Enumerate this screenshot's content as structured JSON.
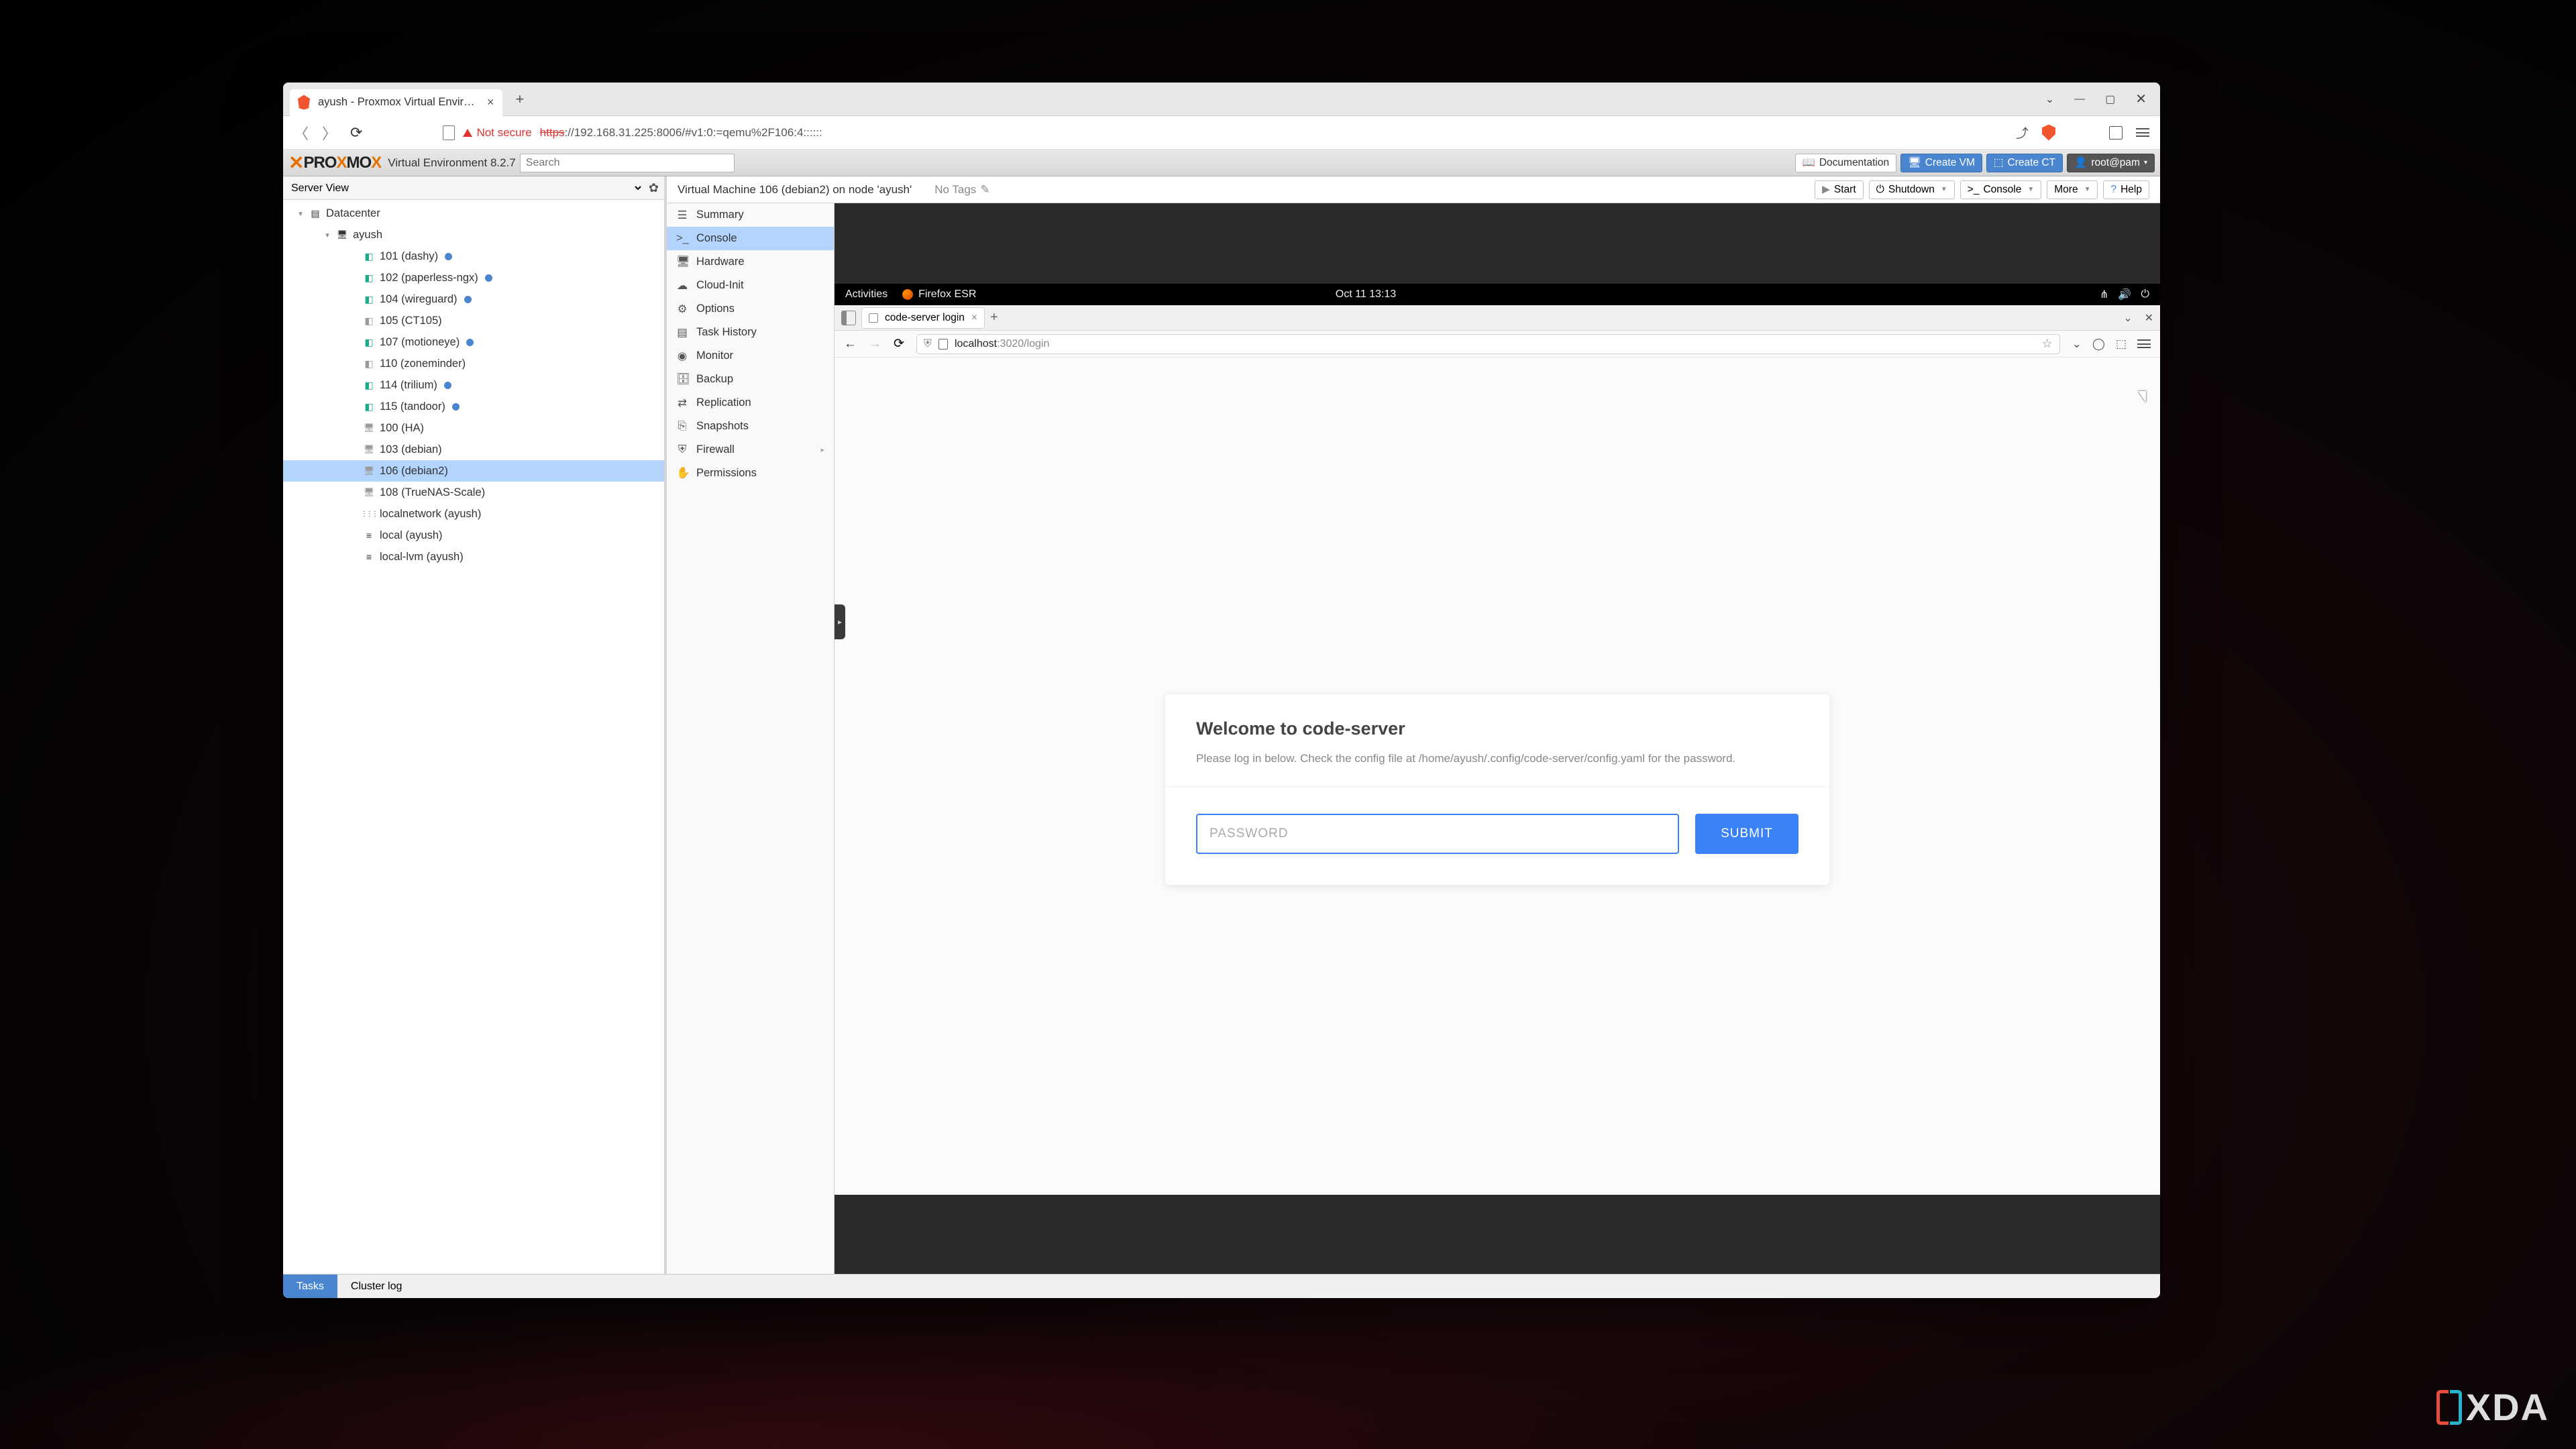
{
  "browser": {
    "tab_title": "ayush - Proxmox Virtual Environment",
    "not_secure": "Not secure",
    "url_proto": "https",
    "url_rest": "://192.168.31.225:8006/#v1:0:=qemu%2F106:4::::::"
  },
  "proxmox": {
    "logo_black": "PRO",
    "logo_x": "X",
    "logo_mo": "MO",
    "ve_label": "Virtual Environment 8.2.7",
    "search_placeholder": "Search",
    "btn_doc": "Documentation",
    "btn_create_vm": "Create VM",
    "btn_create_ct": "Create CT",
    "user": "root@pam",
    "server_view": "Server View",
    "tree": [
      {
        "depth": 0,
        "exp": "▾",
        "icon": "ic-srv",
        "label": "Datacenter",
        "dot": false
      },
      {
        "depth": 1,
        "exp": "▾",
        "icon": "ic-node",
        "label": "ayush",
        "dot": false
      },
      {
        "depth": 2,
        "exp": "",
        "icon": "ic-ct-r",
        "label": "101 (dashy)",
        "dot": true
      },
      {
        "depth": 2,
        "exp": "",
        "icon": "ic-ct-r",
        "label": "102 (paperless-ngx)",
        "dot": true
      },
      {
        "depth": 2,
        "exp": "",
        "icon": "ic-ct-r",
        "label": "104 (wireguard)",
        "dot": true
      },
      {
        "depth": 2,
        "exp": "",
        "icon": "ic-ct",
        "label": "105 (CT105)",
        "dot": false
      },
      {
        "depth": 2,
        "exp": "",
        "icon": "ic-ct-r",
        "label": "107 (motioneye)",
        "dot": true
      },
      {
        "depth": 2,
        "exp": "",
        "icon": "ic-ct",
        "label": "110 (zoneminder)",
        "dot": false
      },
      {
        "depth": 2,
        "exp": "",
        "icon": "ic-ct-r",
        "label": "114 (trilium)",
        "dot": true
      },
      {
        "depth": 2,
        "exp": "",
        "icon": "ic-ct-r",
        "label": "115 (tandoor)",
        "dot": true
      },
      {
        "depth": 2,
        "exp": "",
        "icon": "ic-vm",
        "label": "100 (HA)",
        "dot": false
      },
      {
        "depth": 2,
        "exp": "",
        "icon": "ic-vm",
        "label": "103 (debian)",
        "dot": false
      },
      {
        "depth": 2,
        "exp": "",
        "icon": "ic-vm",
        "label": "106 (debian2)",
        "dot": false,
        "selected": true
      },
      {
        "depth": 2,
        "exp": "",
        "icon": "ic-vm",
        "label": "108 (TrueNAS-Scale)",
        "dot": false
      },
      {
        "depth": 2,
        "exp": "",
        "icon": "ic-net",
        "label": "localnetwork (ayush)",
        "dot": false
      },
      {
        "depth": 2,
        "exp": "",
        "icon": "ic-disk",
        "label": "local (ayush)",
        "dot": false
      },
      {
        "depth": 2,
        "exp": "",
        "icon": "ic-disk",
        "label": "local-lvm (ayush)",
        "dot": false
      }
    ],
    "vm_header": "Virtual Machine 106 (debian2) on node 'ayush'",
    "no_tags": "No Tags",
    "actions": {
      "start": "Start",
      "shutdown": "Shutdown",
      "console": "Console",
      "more": "More",
      "help": "Help"
    },
    "menu": [
      {
        "icon": "☰",
        "label": "Summary"
      },
      {
        "icon": ">_",
        "label": "Console",
        "selected": true
      },
      {
        "icon": "🖥",
        "label": "Hardware"
      },
      {
        "icon": "☁",
        "label": "Cloud-Init"
      },
      {
        "icon": "⚙",
        "label": "Options"
      },
      {
        "icon": "▤",
        "label": "Task History"
      },
      {
        "icon": "◉",
        "label": "Monitor"
      },
      {
        "icon": "🗄",
        "label": "Backup"
      },
      {
        "icon": "⇄",
        "label": "Replication"
      },
      {
        "icon": "⎘",
        "label": "Snapshots"
      },
      {
        "icon": "⛨",
        "label": "Firewall",
        "arrow": true
      },
      {
        "icon": "✋",
        "label": "Permissions"
      }
    ],
    "footer": {
      "tasks": "Tasks",
      "cluster_log": "Cluster log"
    }
  },
  "guest": {
    "activities": "Activities",
    "app": "Firefox ESR",
    "clock": "Oct 11  13:13",
    "tab_title": "code-server login",
    "url_host": "localhost",
    "url_path": ":3020/login",
    "login_title": "Welcome to code-server",
    "login_desc": "Please log in below. Check the config file at /home/ayush/.config/code-server/config.yaml for the password.",
    "pw_placeholder": "PASSWORD",
    "submit": "SUBMIT"
  },
  "watermark": "XDA"
}
